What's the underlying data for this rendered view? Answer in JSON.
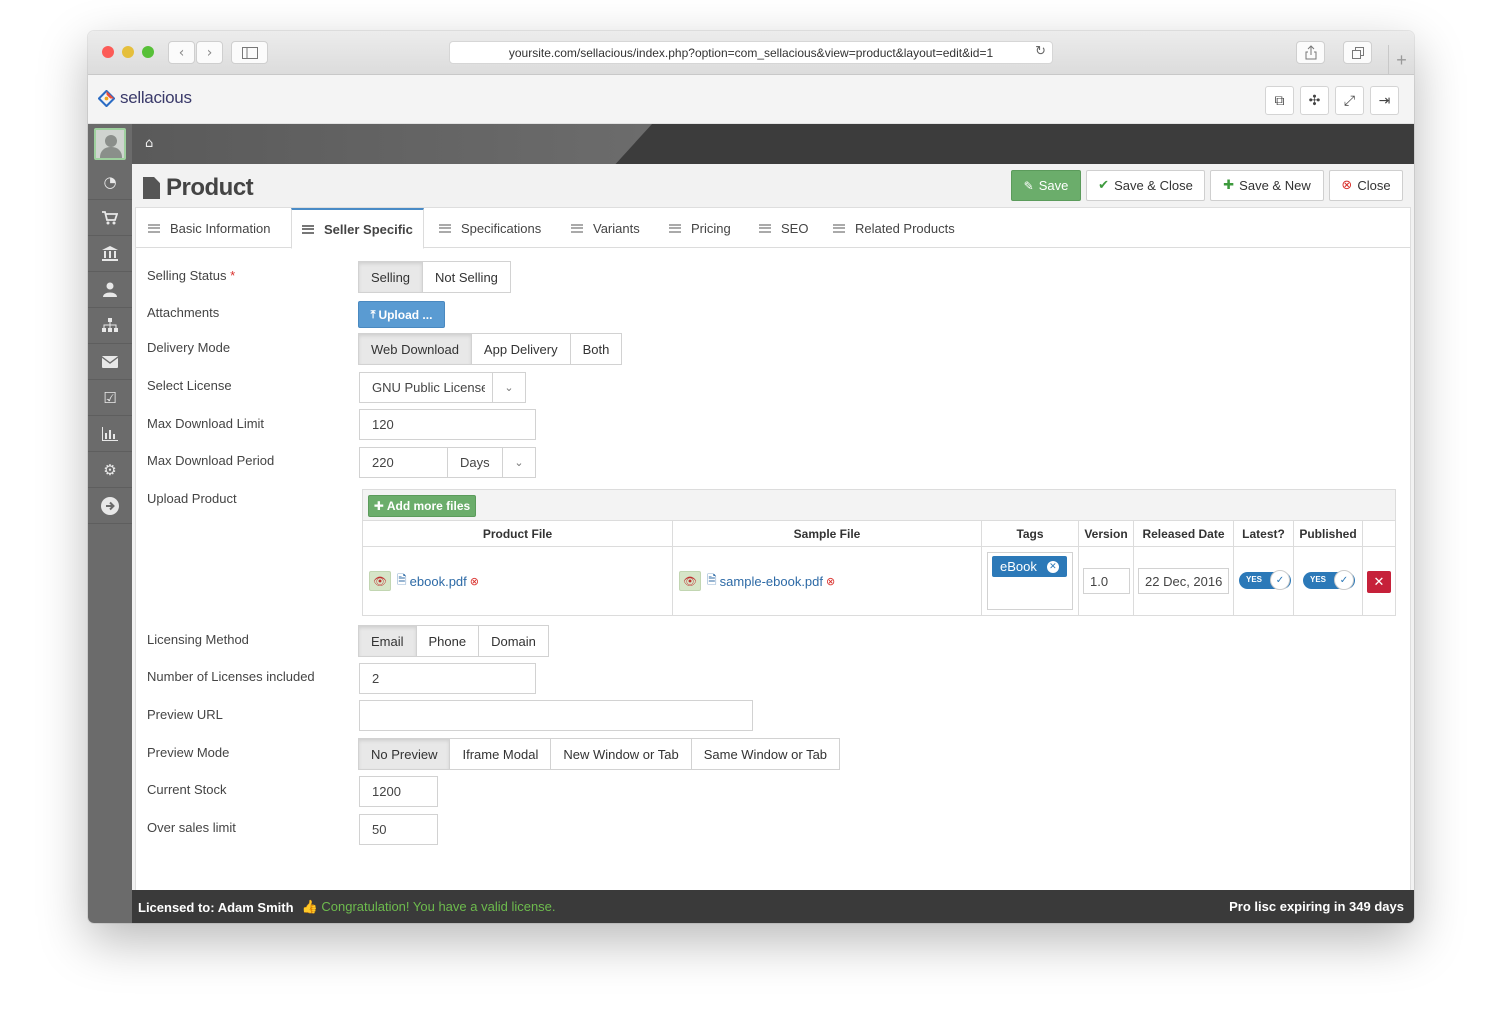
{
  "browser": {
    "url": "yoursite.com/sellacious/index.php?option=com_sellacious&view=product&layout=edit&id=1"
  },
  "app": {
    "logo_text": "sellacious"
  },
  "page": {
    "title": "Product"
  },
  "toolbar": {
    "save": "Save",
    "save_close": "Save & Close",
    "save_new": "Save & New",
    "close": "Close"
  },
  "tabs": [
    {
      "label": "Basic Information"
    },
    {
      "label": "Seller Specific"
    },
    {
      "label": "Specifications"
    },
    {
      "label": "Variants"
    },
    {
      "label": "Pricing"
    },
    {
      "label": "SEO"
    },
    {
      "label": "Related Products"
    }
  ],
  "form": {
    "selling_status": {
      "label": "Selling Status",
      "required": "*",
      "options": [
        "Selling",
        "Not Selling"
      ],
      "selected": "Selling"
    },
    "attachments": {
      "label": "Attachments",
      "button": "Upload ..."
    },
    "delivery_mode": {
      "label": "Delivery Mode",
      "options": [
        "Web Download",
        "App Delivery",
        "Both"
      ],
      "selected": "Web Download"
    },
    "select_license": {
      "label": "Select License",
      "value": "GNU Public License v"
    },
    "max_download_limit": {
      "label": "Max Download Limit",
      "value": "120"
    },
    "max_download_period": {
      "label": "Max Download Period",
      "value": "220",
      "unit": "Days"
    },
    "upload_product": {
      "label": "Upload Product",
      "add_button": "Add more files"
    },
    "licensing_method": {
      "label": "Licensing Method",
      "options": [
        "Email",
        "Phone",
        "Domain"
      ],
      "selected": "Email"
    },
    "num_licenses": {
      "label": "Number of Licenses included",
      "value": "2"
    },
    "preview_url": {
      "label": "Preview URL",
      "value": ""
    },
    "preview_mode": {
      "label": "Preview Mode",
      "options": [
        "No Preview",
        "Iframe Modal",
        "New Window or Tab",
        "Same Window or Tab"
      ],
      "selected": "No Preview"
    },
    "current_stock": {
      "label": "Current Stock",
      "value": "1200"
    },
    "over_sales_limit": {
      "label": "Over sales limit",
      "value": "50"
    }
  },
  "files_table": {
    "headers": [
      "Product File",
      "Sample File",
      "Tags",
      "Version",
      "Released Date",
      "Latest?",
      "Published"
    ],
    "rows": [
      {
        "product_file": "ebook.pdf",
        "sample_file": "sample-ebook.pdf",
        "tag": "eBook",
        "version": "1.0",
        "released_date": "22 Dec, 2016",
        "latest": "YES",
        "published": "YES"
      }
    ]
  },
  "footer": {
    "licensed_to": "Licensed to: Adam Smith",
    "valid_msg": "Congratulation! You have a valid license.",
    "expiry": "Pro lisc expiring in 349 days"
  },
  "colors": {
    "accent_blue": "#2c79b8",
    "save_green": "#6bad6b",
    "danger_red": "#c6213a",
    "sidebar_gray": "#6b6b6b"
  }
}
